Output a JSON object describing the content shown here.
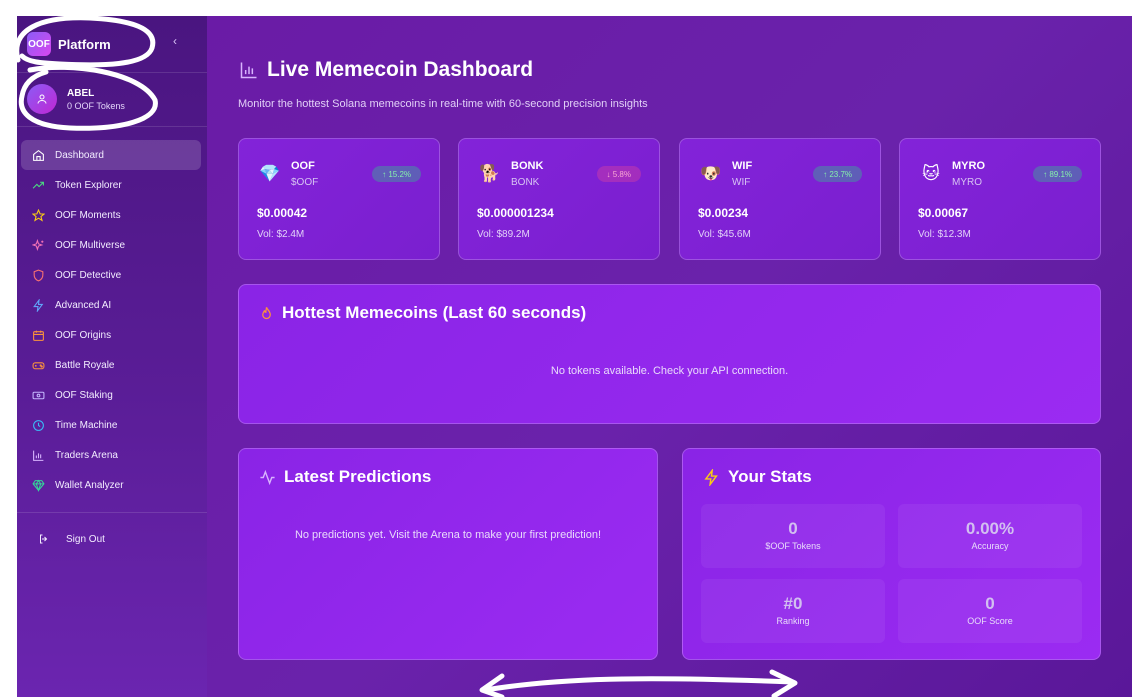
{
  "sidebar": {
    "brand": {
      "logo_text": "OOF",
      "name": "Platform",
      "collapse_icon": "chevron-left-icon"
    },
    "user": {
      "name": "ABEL",
      "tokens": "0 OOF Tokens",
      "avatar_icon": "user-icon"
    },
    "items": [
      {
        "label": "Dashboard",
        "icon": "home-icon",
        "color": "#ffffff",
        "active": true
      },
      {
        "label": "Token Explorer",
        "icon": "trending-up-icon",
        "color": "#4ade80"
      },
      {
        "label": "OOF Moments",
        "icon": "star-icon",
        "color": "#facc15"
      },
      {
        "label": "OOF Multiverse",
        "icon": "sparkles-icon",
        "color": "#f472b6"
      },
      {
        "label": "OOF Detective",
        "icon": "shield-icon",
        "color": "#f87171"
      },
      {
        "label": "Advanced AI",
        "icon": "zap-icon",
        "color": "#60a5fa"
      },
      {
        "label": "OOF Origins",
        "icon": "calendar-icon",
        "color": "#fb923c"
      },
      {
        "label": "Battle Royale",
        "icon": "gamepad-icon",
        "color": "#fb923c"
      },
      {
        "label": "OOF Staking",
        "icon": "banknote-icon",
        "color": "#c4b5fd"
      },
      {
        "label": "Time Machine",
        "icon": "clock-icon",
        "color": "#38bdf8"
      },
      {
        "label": "Traders Arena",
        "icon": "bar-chart-icon",
        "color": "#d8b4fe"
      },
      {
        "label": "Wallet Analyzer",
        "icon": "gem-icon",
        "color": "#34d399"
      }
    ],
    "sign_out": "Sign Out"
  },
  "main": {
    "title": "Live Memecoin Dashboard",
    "subtitle": "Monitor the hottest Solana memecoins in real-time with 60-second precision insights",
    "coins": [
      {
        "name": "OOF",
        "symbol": "$OOF",
        "emoji": "💎",
        "change": "↑ 15.2%",
        "direction": "up",
        "price": "$0.00042",
        "volume": "Vol: $2.4M"
      },
      {
        "name": "BONK",
        "symbol": "BONK",
        "emoji": "🐕",
        "change": "↓ 5.8%",
        "direction": "down",
        "price": "$0.000001234",
        "volume": "Vol: $89.2M"
      },
      {
        "name": "WIF",
        "symbol": "WIF",
        "emoji": "🐶",
        "change": "↑ 23.7%",
        "direction": "up",
        "price": "$0.00234",
        "volume": "Vol: $45.6M"
      },
      {
        "name": "MYRO",
        "symbol": "MYRO",
        "emoji": "🐱",
        "change": "↑ 89.1%",
        "direction": "up",
        "price": "$0.00067",
        "volume": "Vol: $12.3M"
      }
    ],
    "hottest": {
      "title": "Hottest Memecoins (Last 60 seconds)",
      "empty": "No tokens available. Check your API connection."
    },
    "predictions": {
      "title": "Latest Predictions",
      "empty": "No predictions yet. Visit the Arena to make your first prediction!"
    },
    "stats": {
      "title": "Your Stats",
      "items": [
        {
          "value": "0",
          "label": "$OOF Tokens"
        },
        {
          "value": "0.00%",
          "label": "Accuracy"
        },
        {
          "value": "#0",
          "label": "Ranking"
        },
        {
          "value": "0",
          "label": "OOF Score"
        }
      ]
    }
  },
  "colors": {
    "sidebar_bg": "#4a1580",
    "main_bg": "#6a1ba6",
    "panel_bg": "#8a24e6",
    "flame": "#fb923c",
    "bolt": "#facc15",
    "up": "#86efac",
    "down": "#f9a8d4"
  }
}
